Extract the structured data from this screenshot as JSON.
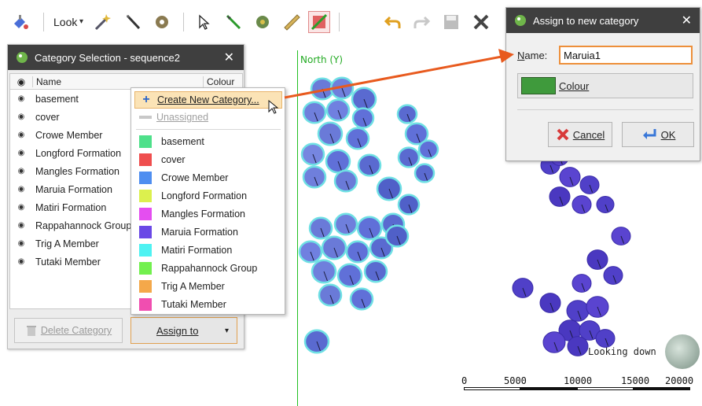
{
  "toolbar": {
    "look_label": "Look",
    "look_caret": "▾",
    "buttons": [
      "paint-bucket-icon",
      "wand-icon",
      "brush-icon",
      "gear-icon",
      "pointer-icon",
      "pen-icon",
      "puzzle-icon",
      "ruler-icon",
      "slice-icon",
      "undo-icon",
      "redo-icon",
      "save-icon",
      "delete-icon"
    ]
  },
  "viewport": {
    "north_label": "North (Y)",
    "looking_down": "Looking down",
    "scale_ticks": [
      "0",
      "5000",
      "10000",
      "15000",
      "20000"
    ]
  },
  "category_panel": {
    "title": "Category Selection - sequence2",
    "close": "✕",
    "columns": {
      "name": "Name",
      "colour": "Colour"
    },
    "eye": "◉",
    "rows": [
      {
        "name": "basement"
      },
      {
        "name": "cover"
      },
      {
        "name": "Crowe Member"
      },
      {
        "name": "Longford Formation"
      },
      {
        "name": "Mangles Formation"
      },
      {
        "name": "Maruia Formation"
      },
      {
        "name": "Matiri Formation"
      },
      {
        "name": "Rappahannock Group"
      },
      {
        "name": "Trig A Member"
      },
      {
        "name": "Tutaki Member"
      }
    ],
    "delete_button": "Delete Category",
    "assign_button": "Assign to",
    "assign_caret": "▾"
  },
  "dropdown": {
    "create_new": "Create New Category...",
    "unassigned": "Unassigned",
    "items": [
      {
        "name": "basement",
        "color": "#4ee08a"
      },
      {
        "name": "cover",
        "color": "#ef4e4e"
      },
      {
        "name": "Crowe Member",
        "color": "#4f8ef0"
      },
      {
        "name": "Longford Formation",
        "color": "#dcf04e"
      },
      {
        "name": "Mangles Formation",
        "color": "#e44ef0"
      },
      {
        "name": "Maruia Formation",
        "color": "#6a48e6"
      },
      {
        "name": "Matiri Formation",
        "color": "#4ef2f2"
      },
      {
        "name": "Rappahannock Group",
        "color": "#72f04e"
      },
      {
        "name": "Trig A Member",
        "color": "#f4a84a"
      },
      {
        "name": "Tutaki Member",
        "color": "#f04eb0"
      }
    ]
  },
  "dialog": {
    "title": "Assign to new category",
    "close": "✕",
    "name_label_u": "N",
    "name_label_rest": "ame:",
    "name_value": "Maruia1",
    "colour_label": "Colour",
    "colour_value": "#3f9a3c",
    "cancel_label": "Cancel",
    "ok_label": "OK"
  },
  "colors": {
    "accent": "#e85a1e",
    "titlebar": "#3f3f3f",
    "north_line": "#22c022"
  }
}
